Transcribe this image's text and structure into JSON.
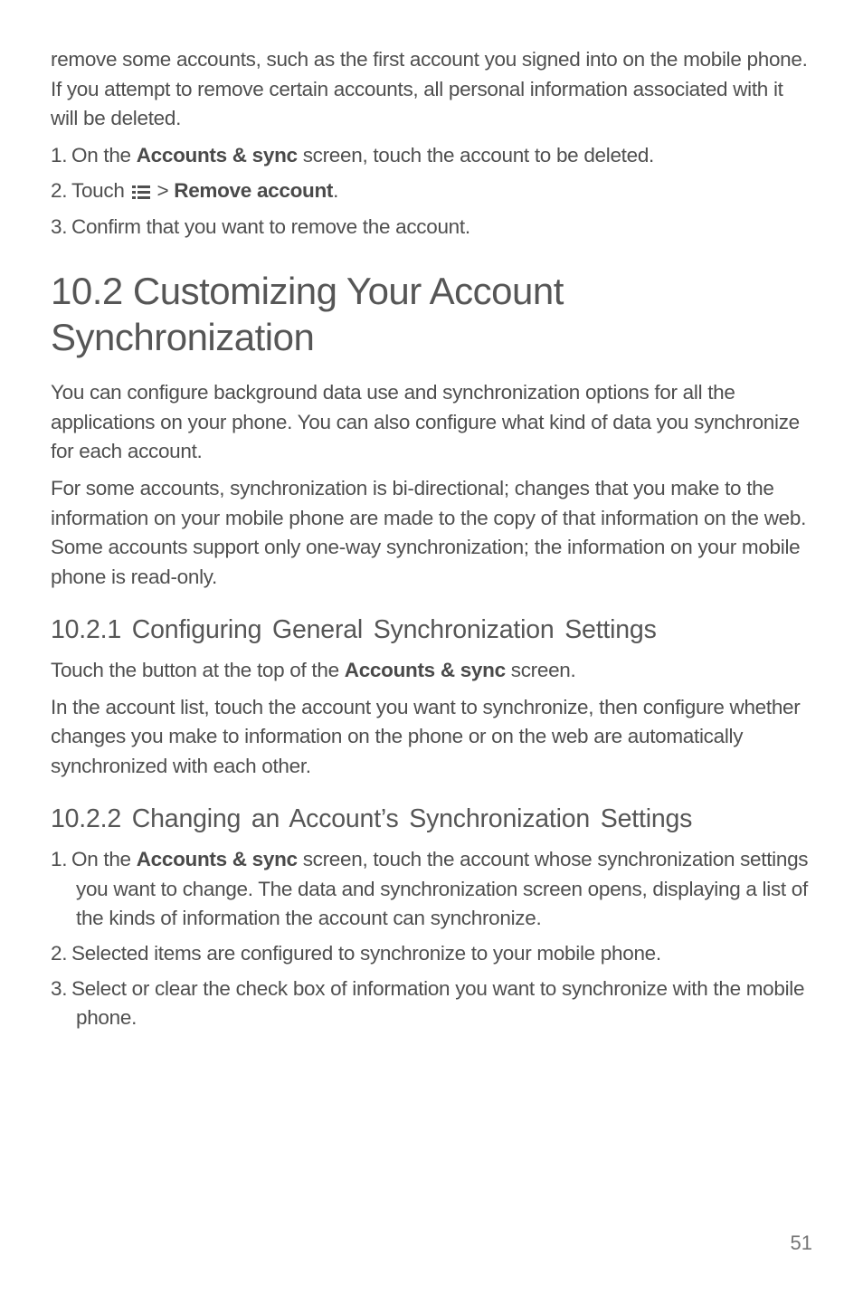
{
  "intro": {
    "p1": "remove some accounts, such as the first account you signed into on the mobile phone. If you attempt to remove certain accounts, all personal information associated with it will be deleted."
  },
  "step_a": {
    "s1_pre": "On the ",
    "s1_bold": "Accounts & sync",
    "s1_post": " screen, touch the account to be deleted.",
    "s2_pre": "Touch  ",
    "s2_mid": "  > ",
    "s2_bold": "Remove account",
    "s2_post": ".",
    "s3": "Confirm that you want to remove the account."
  },
  "section": {
    "title": "10.2  Customizing Your Account Synchronization",
    "p1": "You can configure background data use and synchronization options for all the applications on your phone. You can also configure what kind of data you synchronize for each account.",
    "p2": "For some accounts, synchronization is bi-directional; changes that you make to the information on your mobile phone are made to the copy of that information on the web. Some accounts support only one-way synchronization; the information on your mobile phone is read-only."
  },
  "sub1": {
    "title": "10.2.1  Configuring General Synchronization Settings",
    "p1_pre": "Touch the button at the top of the ",
    "p1_bold": "Accounts & sync",
    "p1_post": " screen.",
    "p2": "In the account list, touch the account you want to synchronize, then configure whether changes you make to information on the phone or on the web are automatically synchronized with each other."
  },
  "sub2": {
    "title": "10.2.2  Changing an Account’s Synchronization Settings",
    "s1_pre": "On the ",
    "s1_bold": "Accounts & sync",
    "s1_post": " screen, touch the account whose synchronization settings you want to change. The data and synchronization screen opens, displaying a list of the kinds of information the account can synchronize.",
    "s2": "Selected items are configured to synchronize to your mobile phone.",
    "s3": "Select or clear the check box of information you want to synchronize with the mobile phone."
  },
  "page_number": "51"
}
